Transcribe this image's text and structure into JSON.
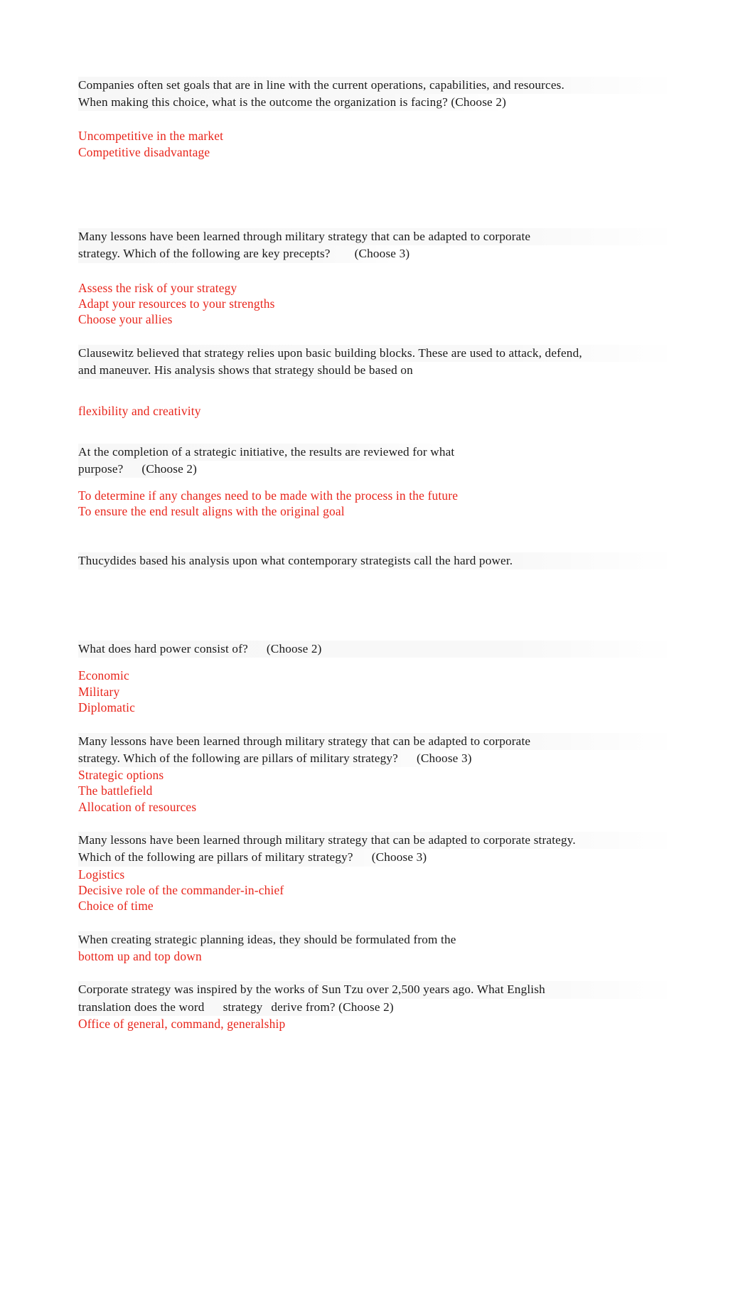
{
  "document": {
    "colors": {
      "question_text": "#1a1a1a",
      "answer_text": "#e8251b",
      "highlight": "#f2f2f2",
      "page_background": "#ffffff"
    }
  },
  "sections": [
    {
      "id": "q1",
      "question_line_1": "Companies often set goals that are in line with the current operations, capabilities, and resources.",
      "question_line_2": "When making this choice, what is the outcome the organization is facing?  (Choose 2)",
      "answers": [
        "Uncompetitive in the market",
        "Competitive disadvantage"
      ]
    },
    {
      "id": "q2",
      "question_line_1": "Many lessons have been learned through military strategy that can be adapted to corporate",
      "question_line_2a": "strategy. Which of the following are key precepts?",
      "question_line_2b": "(Choose 3)",
      "answers": [
        "Assess the risk of your strategy",
        "Adapt your resources to your strengths",
        "Choose your allies"
      ]
    },
    {
      "id": "q3",
      "question_line_1": "Clausewitz believed that strategy relies upon basic building blocks. These are used to attack, defend,",
      "question_line_2": "and maneuver. His analysis shows that strategy should be based on",
      "answers": [
        "flexibility and creativity"
      ]
    },
    {
      "id": "q4",
      "question_line_1": "At the completion of a strategic initiative, the results are reviewed for what",
      "question_line_2a": "purpose?",
      "question_line_2b": "(Choose 2)",
      "answers": [
        "To determine if any changes need to be made with the process in the future",
        "To ensure the end result aligns with the original goal"
      ]
    },
    {
      "id": "q5",
      "question_line_1": "Thucydides based his analysis upon what contemporary strategists call the hard power.",
      "answers": []
    },
    {
      "id": "q6",
      "question_line_1a": "What does hard power consist of?",
      "question_line_1b": "(Choose 2)",
      "answers": [
        "Economic",
        "Military",
        "Diplomatic"
      ]
    },
    {
      "id": "q7",
      "question_line_1": "Many lessons have been learned through military strategy that can be adapted to corporate",
      "question_line_2a": "strategy. Which of the following are pillars of military strategy?",
      "question_line_2b": "(Choose 3)",
      "answers": [
        "Strategic options",
        "The battlefield",
        "Allocation of resources"
      ]
    },
    {
      "id": "q8",
      "question_line_1": "Many lessons have been learned through military strategy that can be adapted to corporate strategy.",
      "question_line_2a": "Which of the following are pillars of military strategy?",
      "question_line_2b": "(Choose 3)",
      "answers": [
        "Logistics",
        "Decisive role of the commander-in-chief",
        "Choice of time"
      ]
    },
    {
      "id": "q9",
      "question_line_1": "When creating strategic planning ideas, they should be formulated from the",
      "answers": [
        "bottom up and top down"
      ]
    },
    {
      "id": "q10",
      "question_line_1": "Corporate strategy was inspired by the works of Sun Tzu over 2,500 years ago. What English",
      "question_line_2a": "translation does the word",
      "question_line_2b": "strategy",
      "question_line_2c": "derive from?  (Choose 2)",
      "answers": [
        "Office of general, command, generalship"
      ]
    }
  ]
}
